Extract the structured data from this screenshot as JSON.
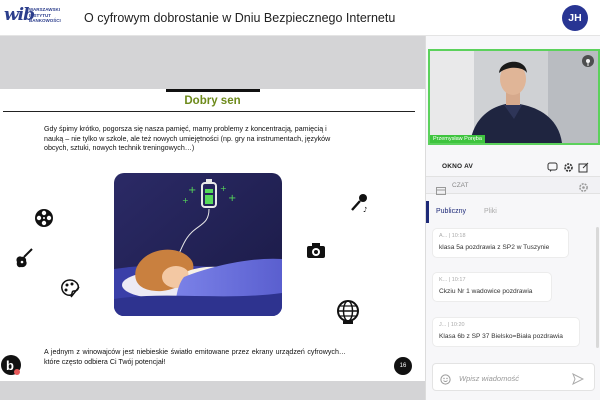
{
  "header": {
    "logo_mark": "wib",
    "logo_text": "WARSZAWSKI INSTYTUT BANKOWOŚCI",
    "title": "O cyfrowym dobrostanie w Dniu Bezpiecznego Internetu",
    "avatar_initials": "JH"
  },
  "slide": {
    "title": "Dobry sen",
    "paragraph1": "Gdy śpimy krótko, pogorsza się nasza pamięć, mamy problemy z koncentracją, pamięcią i nauką – nie tylko w szkole, ale też nowych umiejętności (np. gry na instrumentach, języków obcych, sztuki, nowych technik treningowych…)",
    "paragraph2": "A jednym z winowajców jest niebieskie światło emitowane przez ekrany urządzeń cyfrowych… które często odbiera Ci Twój potencjał!",
    "page_number": "16",
    "bottom_mark": "b",
    "decorations": [
      "film-reel-icon",
      "guitar-icon",
      "palette-icon",
      "microphone-icon",
      "camera-icon",
      "globe-icon"
    ]
  },
  "panel": {
    "speaker_name": "Przemysław Poręba",
    "window_label": "OKNO AV",
    "chat_label": "CZAT",
    "tabs": [
      {
        "label": "Publiczny",
        "active": true
      },
      {
        "label": "Pliki",
        "active": false
      }
    ],
    "messages": [
      {
        "meta": "A... | 10:18",
        "text": "klasa 5a pozdrawia z SP2 w Tuszynie"
      },
      {
        "meta": "K... | 10:17",
        "text": "Ckziu Nr 1 wadowice pozdrawia"
      },
      {
        "meta": "J... | 10:20",
        "text": "Klasa 6b z SP 37 Bielsko=Biała pozdrawia"
      }
    ],
    "input_placeholder": "Wpisz wiadomość"
  },
  "colors": {
    "accent": "#1e2a78",
    "speaker_green": "#3ec43e",
    "slide_title": "#6d8a1a",
    "stage_bg": "#d4d4d6"
  }
}
